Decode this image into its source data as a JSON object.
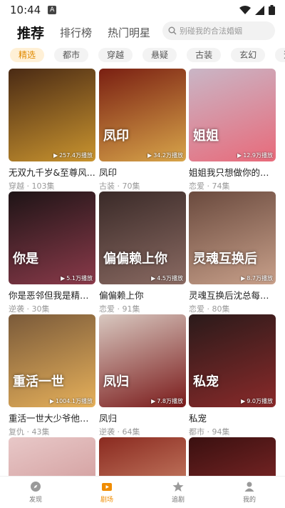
{
  "status_bar": {
    "time": "10:44",
    "app_badge": "A"
  },
  "top_tabs": [
    {
      "label": "推荐",
      "active": true
    },
    {
      "label": "排行榜",
      "active": false
    },
    {
      "label": "热门明星",
      "active": false
    }
  ],
  "search": {
    "placeholder": "别碰我的合法婚姻"
  },
  "categories": [
    {
      "label": "精选",
      "active": true
    },
    {
      "label": "都市",
      "active": false
    },
    {
      "label": "穿越",
      "active": false
    },
    {
      "label": "悬疑",
      "active": false
    },
    {
      "label": "古装",
      "active": false
    },
    {
      "label": "玄幻",
      "active": false
    },
    {
      "label": "逆袭",
      "active": false
    }
  ],
  "dramas": [
    {
      "title": "无双九千岁&至尊风...",
      "genre": "穿越",
      "episodes": "103集",
      "plays": "257.4万播放",
      "poster_text": "",
      "colors": [
        "#4a2a14",
        "#c9942f"
      ]
    },
    {
      "title": "凤印",
      "genre": "古装",
      "episodes": "70集",
      "plays": "34.2万播放",
      "poster_text": "凤印",
      "colors": [
        "#7a1f12",
        "#d8a54a"
      ]
    },
    {
      "title": "姐姐我只想做你的男...",
      "genre": "恋爱",
      "episodes": "74集",
      "plays": "12.9万播放",
      "poster_text": "姐姐",
      "colors": [
        "#c9b6c6",
        "#e86a7a"
      ]
    },
    {
      "title": "你是恶邻但我是精神病",
      "genre": "逆袭",
      "episodes": "30集",
      "plays": "5.1万播放",
      "poster_text": "你是",
      "colors": [
        "#1e1416",
        "#8a3a4a"
      ]
    },
    {
      "title": "偏偏赖上你",
      "genre": "恋爱",
      "episodes": "91集",
      "plays": "4.5万播放",
      "poster_text": "偏偏赖上你",
      "colors": [
        "#3a2a28",
        "#8a6a62"
      ]
    },
    {
      "title": "灵魂互换后沈总每天...",
      "genre": "恋爱",
      "episodes": "80集",
      "plays": "8.7万播放",
      "poster_text": "灵魂互换后",
      "colors": [
        "#6a4a3e",
        "#c8a08a"
      ]
    },
    {
      "title": "重活一世大少爷他杀...",
      "genre": "复仇",
      "episodes": "43集",
      "plays": "1004.1万播放",
      "poster_text": "重活一世",
      "colors": [
        "#7a5a3a",
        "#e6b05a"
      ]
    },
    {
      "title": "凤归",
      "genre": "逆袭",
      "episodes": "64集",
      "plays": "7.8万播放",
      "poster_text": "凤归",
      "colors": [
        "#d8c8c0",
        "#7a1a1a"
      ]
    },
    {
      "title": "私宠",
      "genre": "都市",
      "episodes": "94集",
      "plays": "9.0万播放",
      "poster_text": "私宠",
      "colors": [
        "#2a1a1a",
        "#8a2a2a"
      ]
    },
    {
      "title": "",
      "genre": "",
      "episodes": "",
      "plays": "",
      "poster_text": "",
      "colors": [
        "#e8c8c8",
        "#c88a8a"
      ]
    },
    {
      "title": "",
      "genre": "",
      "episodes": "",
      "plays": "",
      "poster_text": "",
      "colors": [
        "#8a2a20",
        "#e0a080"
      ]
    },
    {
      "title": "",
      "genre": "",
      "episodes": "",
      "plays": "",
      "poster_text": "",
      "colors": [
        "#3a1010",
        "#9a3030"
      ]
    }
  ],
  "bottom_nav": [
    {
      "label": "发现",
      "icon": "compass-icon",
      "active": false
    },
    {
      "label": "剧场",
      "icon": "play-box-icon",
      "active": true
    },
    {
      "label": "追剧",
      "icon": "star-icon",
      "active": false
    },
    {
      "label": "我的",
      "icon": "person-icon",
      "active": false
    }
  ],
  "colors": {
    "accent": "#f08c00",
    "chip_active_bg": "#fff0d6"
  }
}
